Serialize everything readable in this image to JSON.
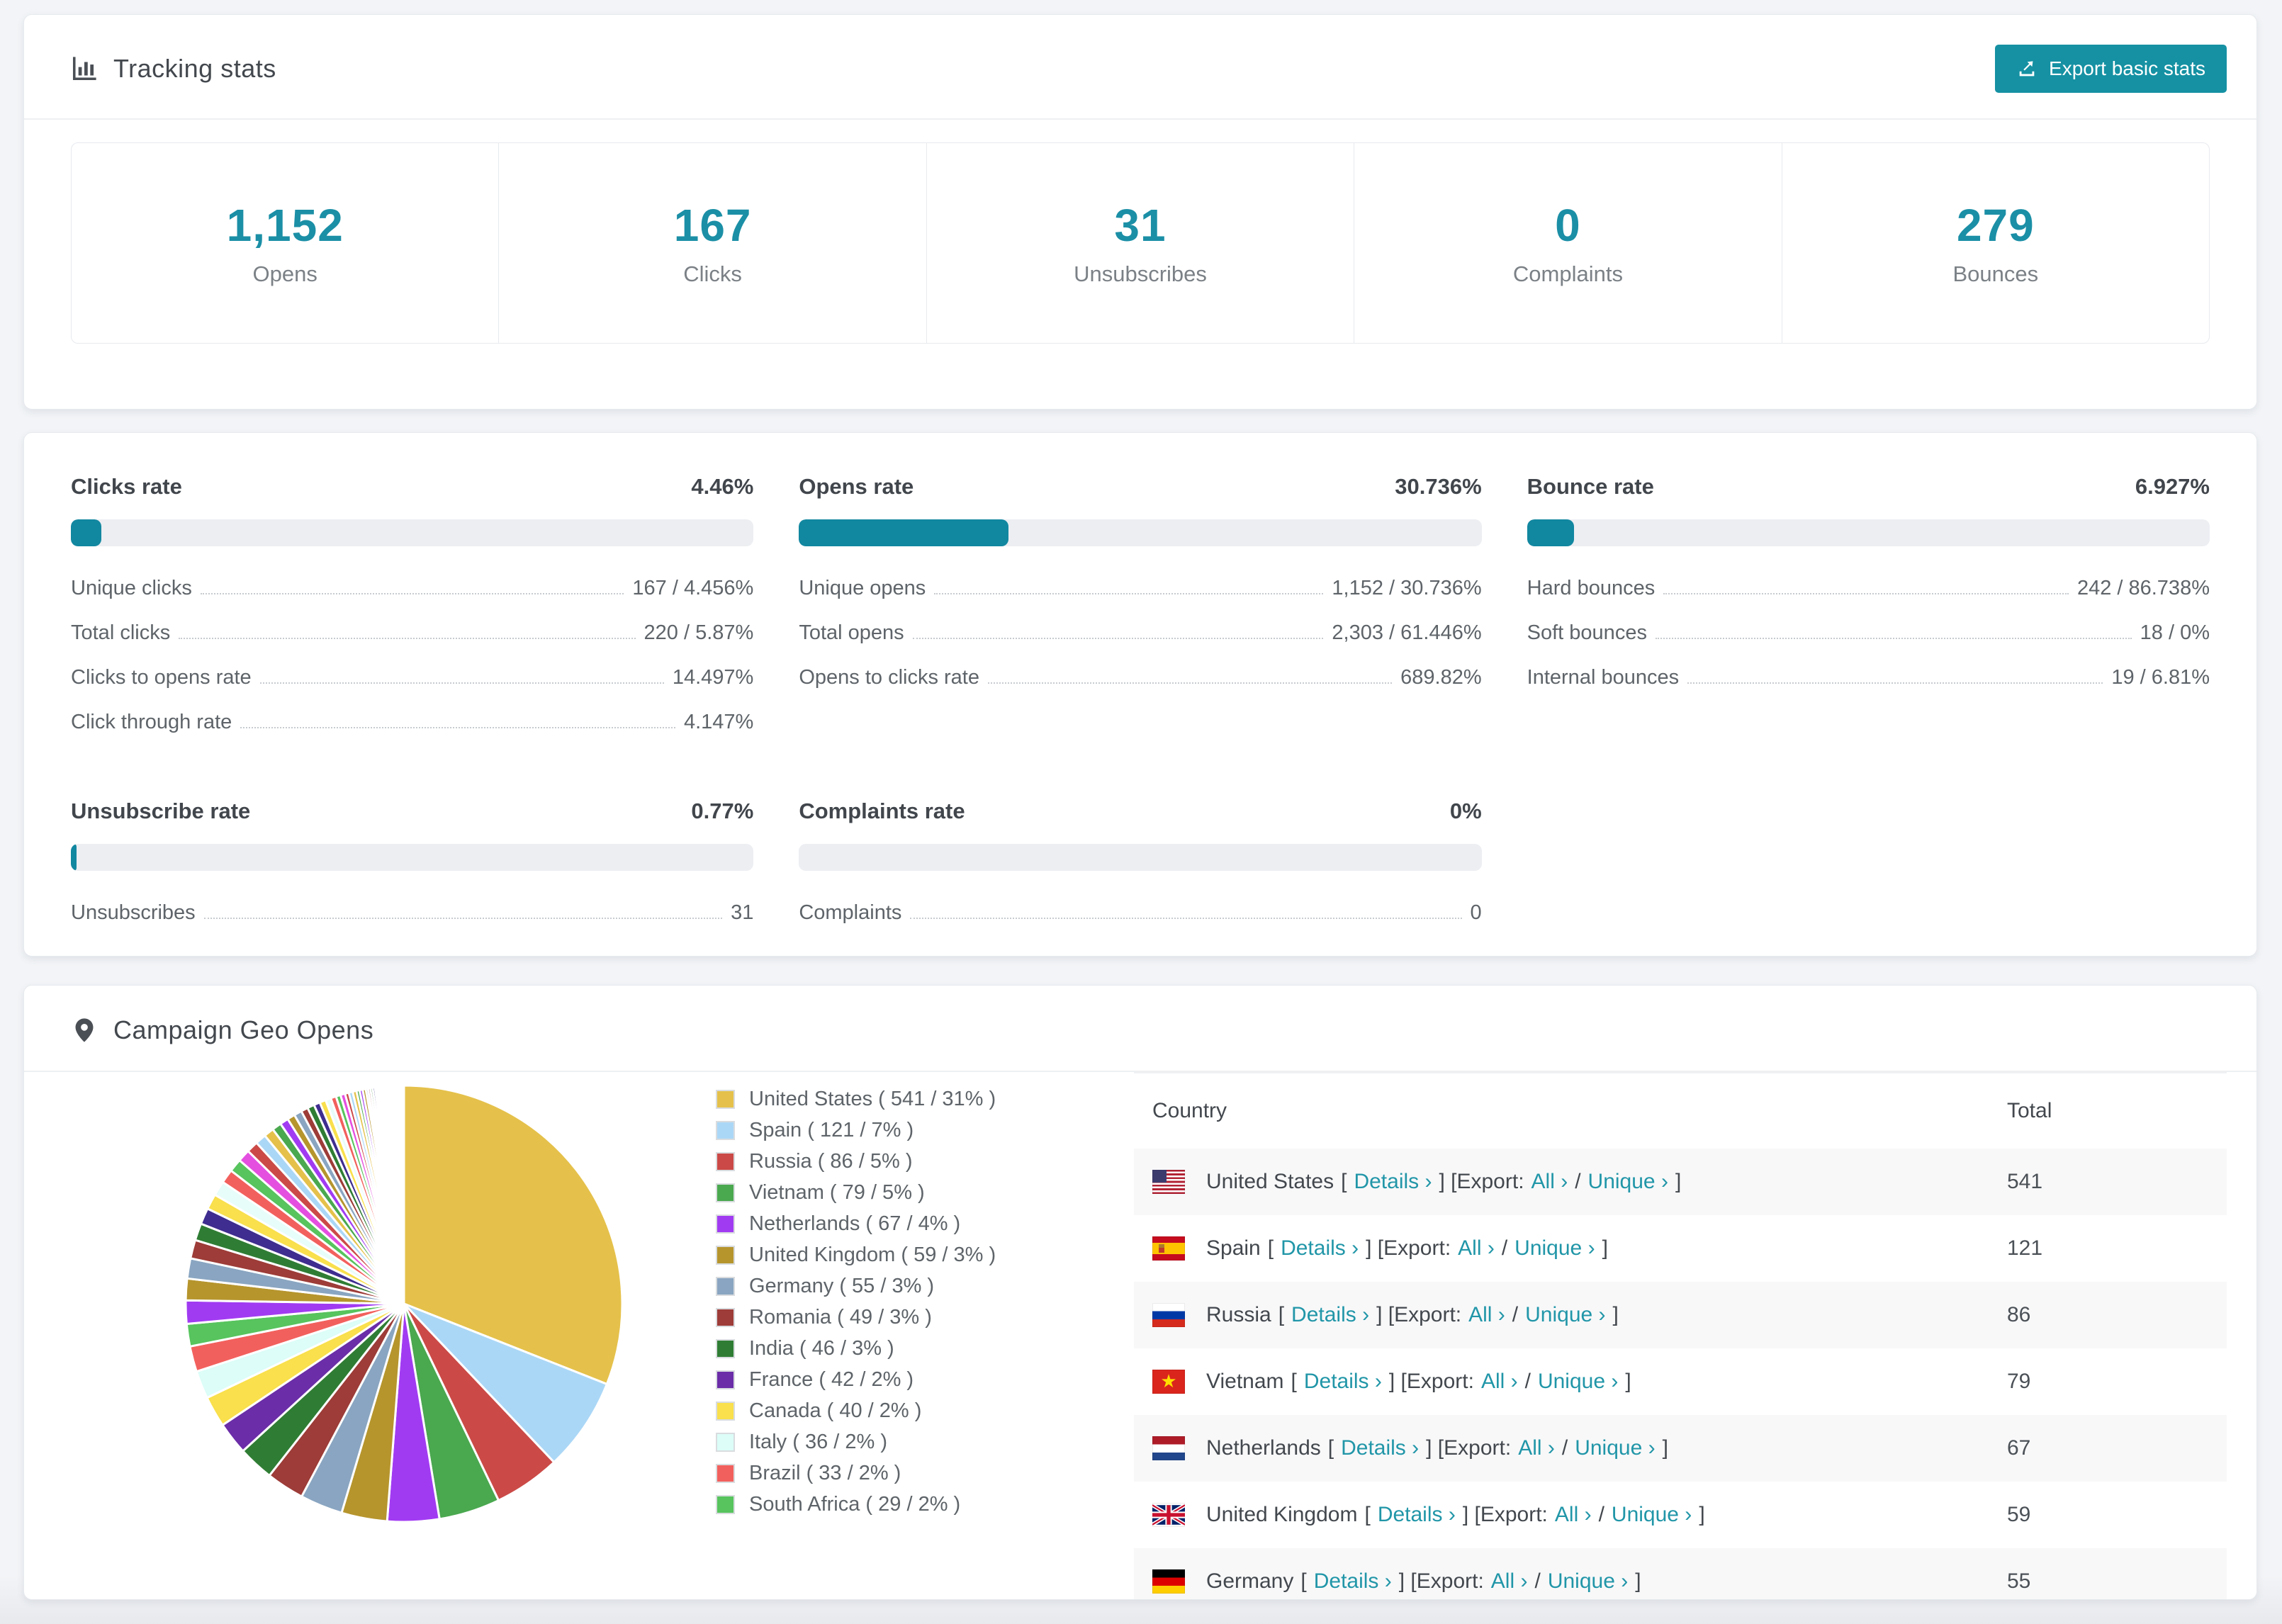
{
  "accent": "#1591a3",
  "tracking": {
    "title": "Tracking stats",
    "export_label": "Export basic stats",
    "stats": [
      {
        "value": "1,152",
        "label": "Opens"
      },
      {
        "value": "167",
        "label": "Clicks"
      },
      {
        "value": "31",
        "label": "Unsubscribes"
      },
      {
        "value": "0",
        "label": "Complaints"
      },
      {
        "value": "279",
        "label": "Bounces"
      }
    ]
  },
  "rates": {
    "panels": [
      {
        "title": "Clicks rate",
        "value": "4.46%",
        "percent": 4.46,
        "rows": [
          {
            "label": "Unique clicks",
            "value": "167 / 4.456%"
          },
          {
            "label": "Total clicks",
            "value": "220 / 5.87%"
          },
          {
            "label": "Clicks to opens rate",
            "value": "14.497%"
          },
          {
            "label": "Click through rate",
            "value": "4.147%"
          }
        ]
      },
      {
        "title": "Opens rate",
        "value": "30.736%",
        "percent": 30.736,
        "rows": [
          {
            "label": "Unique opens",
            "value": "1,152 / 30.736%"
          },
          {
            "label": "Total opens",
            "value": "2,303 / 61.446%"
          },
          {
            "label": "Opens to clicks rate",
            "value": "689.82%"
          }
        ]
      },
      {
        "title": "Bounce rate",
        "value": "6.927%",
        "percent": 6.927,
        "rows": [
          {
            "label": "Hard bounces",
            "value": "242 / 86.738%"
          },
          {
            "label": "Soft bounces",
            "value": "18 / 0%"
          },
          {
            "label": "Internal bounces",
            "value": "19 / 6.81%"
          }
        ]
      },
      {
        "title": "Unsubscribe rate",
        "value": "0.77%",
        "percent": 0.77,
        "rows": [
          {
            "label": "Unsubscribes",
            "value": "31"
          }
        ]
      },
      {
        "title": "Complaints rate",
        "value": "0%",
        "percent": 0,
        "rows": [
          {
            "label": "Complaints",
            "value": "0"
          }
        ]
      }
    ]
  },
  "geo": {
    "title": "Campaign Geo Opens",
    "table": {
      "country_header": "Country",
      "total_header": "Total",
      "links": {
        "lb": "[",
        "details": "Details ›",
        "export_mid": "] [Export:",
        "all": "All ›",
        "slash": "/",
        "unique": "Unique ›",
        "rb": "]"
      },
      "rows": [
        {
          "country": "United States",
          "total": "541",
          "flag": "us"
        },
        {
          "country": "Spain",
          "total": "121",
          "flag": "es"
        },
        {
          "country": "Russia",
          "total": "86",
          "flag": "ru"
        },
        {
          "country": "Vietnam",
          "total": "79",
          "flag": "vn"
        },
        {
          "country": "Netherlands",
          "total": "67",
          "flag": "nl"
        },
        {
          "country": "United Kingdom",
          "total": "59",
          "flag": "gb"
        },
        {
          "country": "Germany",
          "total": "55",
          "flag": "de"
        }
      ]
    }
  },
  "chart_data": {
    "type": "pie",
    "title": "Campaign Geo Opens",
    "legend_position": "right",
    "start_angle_deg": 0,
    "direction": "clockwise",
    "slices": [
      {
        "label": "United States",
        "value": 541,
        "pct": "31%",
        "color": "#e5c14b",
        "legend": "United States ( 541 / 31% )"
      },
      {
        "label": "Spain",
        "value": 121,
        "pct": "7%",
        "color": "#abd7f6",
        "legend": "Spain ( 121 / 7% )"
      },
      {
        "label": "Russia",
        "value": 86,
        "pct": "5%",
        "color": "#cb4a47",
        "legend": "Russia ( 86 / 5% )"
      },
      {
        "label": "Vietnam",
        "value": 79,
        "pct": "5%",
        "color": "#4aa84f",
        "legend": "Vietnam ( 79 / 5% )"
      },
      {
        "label": "Netherlands",
        "value": 67,
        "pct": "4%",
        "color": "#a13bf2",
        "legend": "Netherlands ( 67 / 4% )"
      },
      {
        "label": "United Kingdom",
        "value": 59,
        "pct": "3%",
        "color": "#b6952d",
        "legend": "United Kingdom ( 59 / 3% )"
      },
      {
        "label": "Germany",
        "value": 55,
        "pct": "3%",
        "color": "#89a5c1",
        "legend": "Germany ( 55 / 3% )"
      },
      {
        "label": "Romania",
        "value": 49,
        "pct": "3%",
        "color": "#9d3c38",
        "legend": "Romania ( 49 / 3% )"
      },
      {
        "label": "India",
        "value": 46,
        "pct": "3%",
        "color": "#2f7d34",
        "legend": "India ( 46 / 3% )"
      },
      {
        "label": "France",
        "value": 42,
        "pct": "2%",
        "color": "#6b2da8",
        "legend": "France ( 42 / 2% )"
      },
      {
        "label": "Canada",
        "value": 40,
        "pct": "2%",
        "color": "#f9e04c",
        "legend": "Canada ( 40 / 2% )"
      },
      {
        "label": "Italy",
        "value": 36,
        "pct": "2%",
        "color": "#dcfdf8",
        "legend": "Italy ( 36 / 2% )"
      },
      {
        "label": "Brazil",
        "value": 33,
        "pct": "2%",
        "color": "#f2605d",
        "legend": "Brazil ( 33 / 2% )"
      },
      {
        "label": "South Africa",
        "value": 29,
        "pct": "2%",
        "color": "#57c45d",
        "legend": "South Africa ( 29 / 2% )"
      }
    ],
    "other_values": [
      30,
      28,
      26,
      24,
      22,
      21,
      20,
      19,
      18,
      17,
      16,
      15,
      14,
      13,
      12,
      11,
      10,
      10,
      9,
      9,
      8,
      8,
      7,
      7,
      6,
      6,
      5,
      5,
      5,
      4,
      4,
      4,
      3,
      3,
      3,
      3,
      2,
      2,
      2,
      2,
      2,
      1,
      1,
      1,
      1,
      1,
      1,
      1,
      1,
      1,
      1,
      1,
      1,
      1,
      1,
      1,
      1,
      1,
      1,
      1,
      1,
      1,
      1,
      1,
      1,
      1,
      1,
      1
    ],
    "other_palette": [
      "#a13bf2",
      "#b6952d",
      "#89a5c1",
      "#9d3c38",
      "#2f7d34",
      "#3f2d8f",
      "#f9e04c",
      "#e7fdfa",
      "#f2605d",
      "#57c45d",
      "#e44fe0",
      "#cb4a47",
      "#abd7f6",
      "#e5c14b",
      "#4aa84f"
    ]
  }
}
